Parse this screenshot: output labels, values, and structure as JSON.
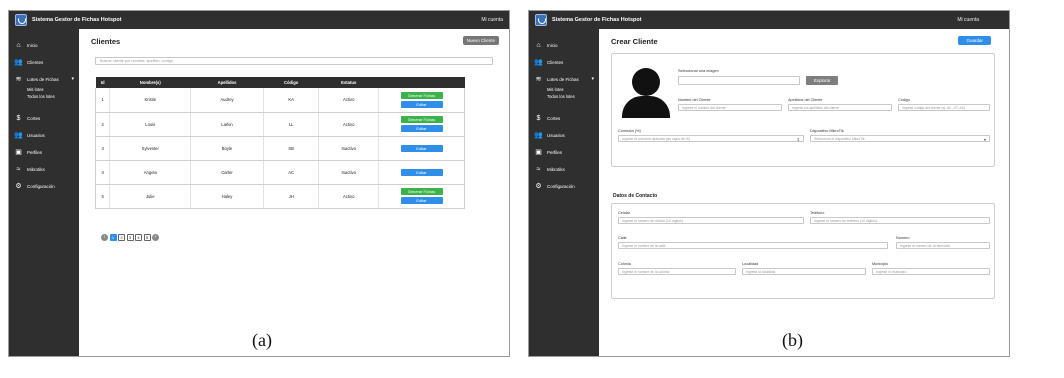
{
  "app": {
    "title": "Sistema Gestor de Fichas Hotspot",
    "account": "Mi cuenta"
  },
  "sidebar": {
    "items": [
      {
        "label": "Inicio",
        "icon": "home-icon"
      },
      {
        "label": "Clientes",
        "icon": "users-icon"
      },
      {
        "label": "Lotes de Fichas",
        "icon": "layers-icon"
      },
      {
        "label": "Cortes",
        "icon": "dollar-icon"
      },
      {
        "label": "Usuarios",
        "icon": "group-icon"
      },
      {
        "label": "Perfiles",
        "icon": "id-card-icon"
      },
      {
        "label": "Mikrotiks",
        "icon": "wifi-icon"
      },
      {
        "label": "Configuración",
        "icon": "gear-icon"
      }
    ],
    "subitems": [
      "Mis lotes",
      "Todos los lotes"
    ]
  },
  "clients_page": {
    "title": "Clientes",
    "new_button": "Nuevo Cliente",
    "search_placeholder": "Buscar cliente por nombre, apellido, código",
    "columns": [
      "Id",
      "Nombre(s)",
      "Apellidos",
      "Código",
      "Estatus"
    ],
    "rows": [
      {
        "id": "1",
        "name": "Kristie",
        "last": "Audrey",
        "code": "KA",
        "status": "Activo",
        "generate": true
      },
      {
        "id": "2",
        "name": "Louis",
        "last": "Larkin",
        "code": "LL",
        "status": "Activo",
        "generate": true
      },
      {
        "id": "3",
        "name": "Sylvester",
        "last": "Boyle",
        "code": "SB",
        "status": "Inactivo",
        "generate": false
      },
      {
        "id": "4",
        "name": "Angela",
        "last": "Carter",
        "code": "AC",
        "status": "Inactivo",
        "generate": false
      },
      {
        "id": "5",
        "name": "Julie",
        "last": "Haley",
        "code": "JH",
        "status": "Activo",
        "generate": true
      }
    ],
    "generate_label": "Generar Fichas",
    "edit_label": "Editar",
    "pages": [
      "1",
      "2",
      "3",
      "4",
      "5"
    ]
  },
  "create_page": {
    "title": "Crear Cliente",
    "save_button": "Guardar",
    "select_image_label": "Seleccionar una imagen",
    "explore_button": "Explorar",
    "name_label": "Nombre del Cliente",
    "name_placeholder": "Ingrese el nombre del cliente",
    "last_label": "Apellidos del Cliente",
    "last_placeholder": "Ingrese los apellidos del cliente",
    "code_label": "Código",
    "code_placeholder": "Ingrese código del cliente (ej. AC, DT, AS)",
    "commission_label": "Comisión (%)",
    "commission_placeholder": "Ingrese la comisión aplicada (sin signo de %)",
    "device_label": "Dispositivo MikroTik",
    "device_placeholder": "Seleccione el dispositivo MikroTik",
    "contact_title": "Datos de Contacto",
    "cell_label": "Celular",
    "cell_placeholder": "Ingrese el número de celular (10 dígitos)",
    "phone_label": "Teléfono",
    "phone_placeholder": "Ingrese el número de teléfono (10 dígitos)",
    "street_label": "Calle",
    "street_placeholder": "Ingrese el nombre de la calle",
    "number_label": "Número",
    "number_placeholder": "Ingrese el número de la dirección",
    "colony_label": "Colonia",
    "colony_placeholder": "Ingrese el nombre de la colonia",
    "locality_label": "Localidad",
    "locality_placeholder": "Ingrese la localidad",
    "municipality_label": "Municipio",
    "municipality_placeholder": "Ingrese el municipio"
  },
  "captions": {
    "a": "(a)",
    "b": "(b)"
  },
  "colors": {
    "sidebar": "#2f2f2f",
    "primary": "#2f8ee8",
    "success": "#3bb34a",
    "secondary": "#777777"
  }
}
